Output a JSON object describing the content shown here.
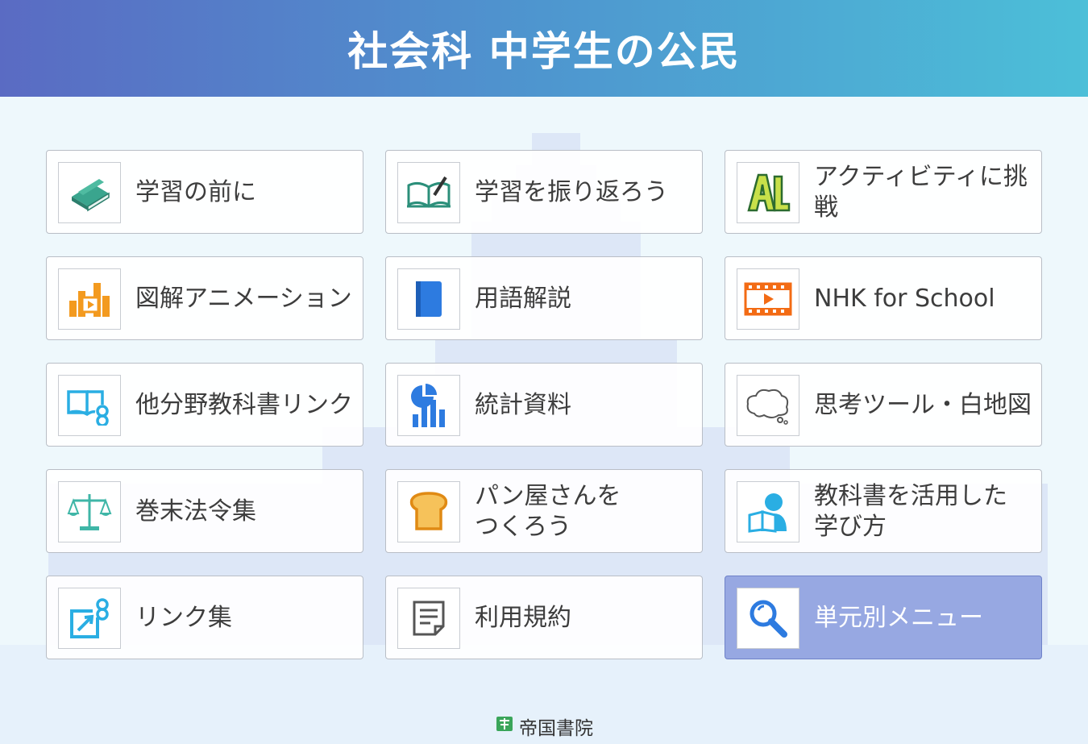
{
  "header": {
    "title": "社会科 中学生の公民"
  },
  "menu": [
    {
      "label": "学習の前に",
      "icon": "book-icon"
    },
    {
      "label": "学習を振り返ろう",
      "icon": "open-book-pen-icon"
    },
    {
      "label": "アクティビティに挑戦",
      "icon": "al-logo-icon"
    },
    {
      "label": "図解アニメーション",
      "icon": "animation-chart-icon"
    },
    {
      "label": "用語解説",
      "icon": "dictionary-icon"
    },
    {
      "label": "NHK for School",
      "icon": "film-play-icon"
    },
    {
      "label": "他分野教科書リンク",
      "icon": "book-link-icon"
    },
    {
      "label": "統計資料",
      "icon": "statistics-icon"
    },
    {
      "label": "思考ツール・白地図",
      "icon": "thought-bubble-icon"
    },
    {
      "label": "巻末法令集",
      "icon": "scales-icon"
    },
    {
      "label": "パン屋さんを\nつくろう",
      "icon": "bread-icon"
    },
    {
      "label": "教科書を活用した\n学び方",
      "icon": "student-reading-icon"
    },
    {
      "label": "リンク集",
      "icon": "external-link-icon"
    },
    {
      "label": "利用規約",
      "icon": "document-icon"
    },
    {
      "label": "単元別メニュー",
      "icon": "search-icon",
      "active": true
    }
  ],
  "footer": {
    "publisher": "帝国書院"
  },
  "colors": {
    "accent": "#97a8e2",
    "header_start": "#5a6bc3",
    "header_end": "#4cbfd8"
  }
}
